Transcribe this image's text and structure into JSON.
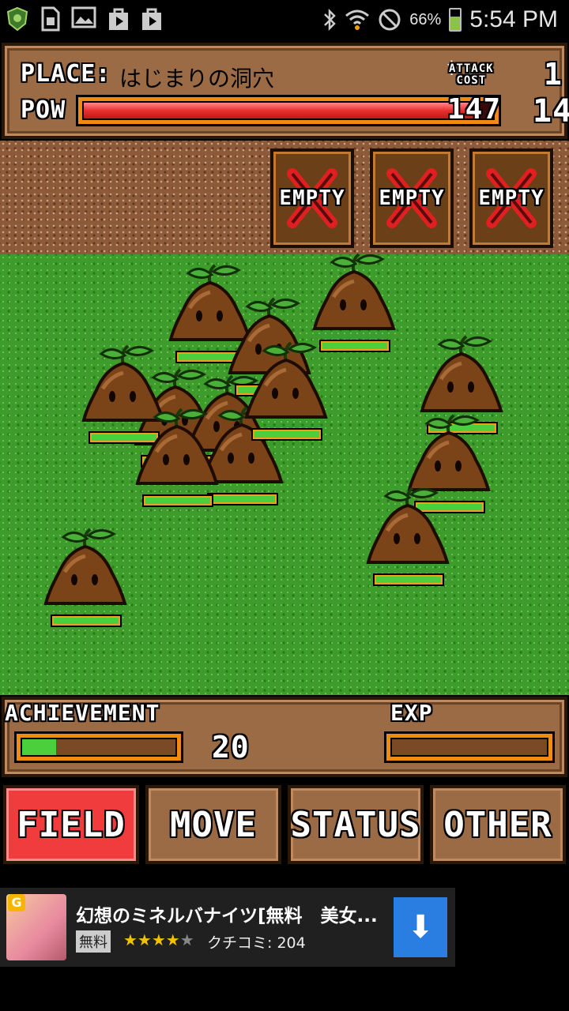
{
  "status_bar": {
    "battery_percent": "66%",
    "battery_level": 0.66,
    "time": "5:54 PM",
    "icons": [
      "shield-app-icon",
      "sim-card-icon",
      "image-icon",
      "play-store-icon",
      "play-store-icon",
      "bluetooth-icon",
      "wifi-icon",
      "no-sound-icon",
      "battery-icon"
    ]
  },
  "header": {
    "place_label": "PLACE:",
    "place_name": "はじまりの洞穴",
    "pow_label": "POW",
    "pow_value": "147",
    "pow_fill": 0.97,
    "attack_cost_label_line1": "ATTACK",
    "attack_cost_label_line2": "COST",
    "attack_cost_current": "1",
    "attack_cost_max": "14"
  },
  "slots": [
    {
      "label": "EMPTY"
    },
    {
      "label": "EMPTY"
    },
    {
      "label": "EMPTY"
    }
  ],
  "monsters": [
    {
      "name": "sprout-monster",
      "hp": 1.0
    },
    {
      "name": "sprout-monster",
      "hp": 1.0
    },
    {
      "name": "sprout-monster",
      "hp": 1.0
    },
    {
      "name": "sprout-monster",
      "hp": 1.0
    },
    {
      "name": "sprout-monster",
      "hp": 1.0
    },
    {
      "name": "sprout-monster",
      "hp": 1.0
    },
    {
      "name": "sprout-monster",
      "hp": 1.0
    },
    {
      "name": "sprout-monster",
      "hp": 1.0
    },
    {
      "name": "sprout-monster",
      "hp": 1.0
    },
    {
      "name": "sprout-monster",
      "hp": 1.0
    },
    {
      "name": "sprout-monster",
      "hp": 1.0
    },
    {
      "name": "sprout-monster",
      "hp": 1.0
    },
    {
      "name": "sprout-monster",
      "hp": 1.0
    }
  ],
  "bottom": {
    "achievement_label": "ACHIEVEMENT",
    "achievement_fill": 0.22,
    "achievement_value": "20",
    "exp_label": "EXP",
    "exp_fill": 0.0
  },
  "tabs": [
    {
      "label": "FIELD",
      "active": true
    },
    {
      "label": "MOVE",
      "active": false
    },
    {
      "label": "STATUS",
      "active": false
    },
    {
      "label": "OTHER",
      "active": false
    }
  ],
  "ad": {
    "title": "幻想のミネルバナイツ[無料　美女...",
    "free_badge": "無料",
    "rating_stars": 4,
    "stars_text": "★★★★",
    "stars_off_text": "★",
    "review": "クチコミ: 204",
    "logo_letter": "G"
  },
  "colors": {
    "pow_bar": "#e83030",
    "hp_bar": "#4ccf3c",
    "active_tab": "#f03c3c",
    "wood": "#9a6b45",
    "ad_button": "#2a7de1"
  }
}
